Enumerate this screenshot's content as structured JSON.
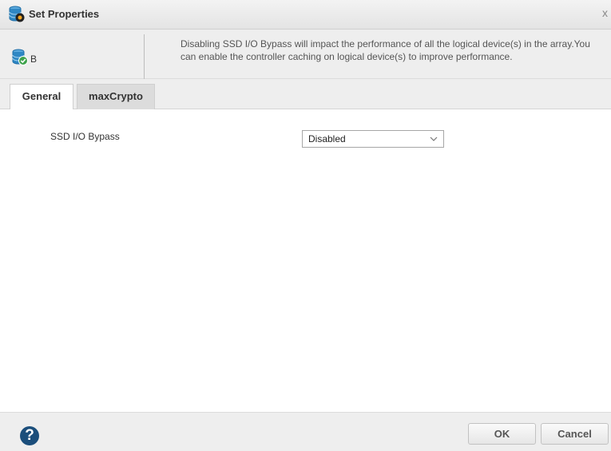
{
  "window": {
    "title": "Set Properties",
    "close_glyph": "x"
  },
  "header": {
    "device_name": "B",
    "info_message": "Disabling SSD I/O Bypass will impact the performance of all the logical device(s) in the array.You can enable the controller caching on logical device(s) to improve performance."
  },
  "tabs": [
    {
      "label": "General",
      "active": true
    },
    {
      "label": "maxCrypto",
      "active": false
    }
  ],
  "general": {
    "ssd_io_bypass": {
      "label": "SSD I/O Bypass",
      "value": "Disabled"
    }
  },
  "footer": {
    "help_glyph": "?",
    "ok_label": "OK",
    "cancel_label": "Cancel"
  },
  "colors": {
    "icon_blue": "#2e87c4",
    "check_green": "#3fa34d",
    "help_navy": "#1b4e7b"
  },
  "icons": [
    "database-settings-icon",
    "database-check-icon",
    "help-icon",
    "chevron-down-icon"
  ]
}
